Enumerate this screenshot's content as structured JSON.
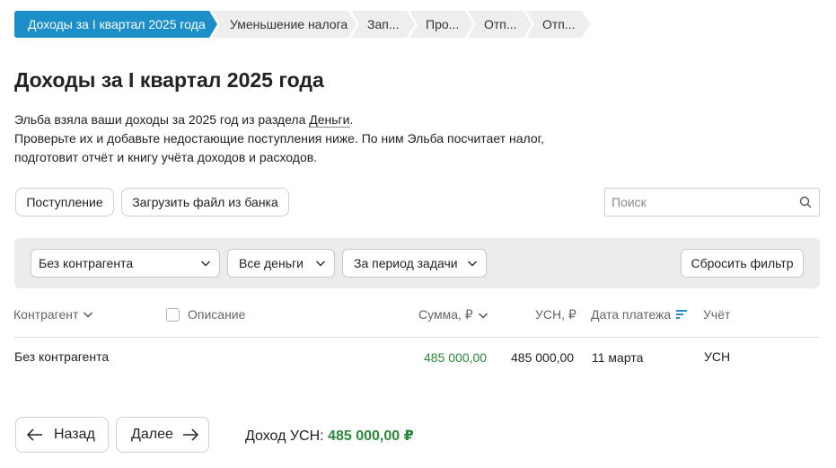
{
  "stepper": {
    "steps": [
      {
        "label": "Доходы за I квартал 2025 года",
        "active": true
      },
      {
        "label": "Уменьшение налога",
        "active": false
      },
      {
        "label": "Зап...",
        "active": false
      },
      {
        "label": "Про...",
        "active": false
      },
      {
        "label": "Отп...",
        "active": false
      },
      {
        "label": "Отп...",
        "active": false
      }
    ]
  },
  "page": {
    "title": "Доходы за I квартал 2025 года",
    "desc_line1_before": "Эльба взяла ваши доходы за 2025 год из раздела ",
    "desc_link": "Деньги",
    "desc_line1_after": ".",
    "desc_line2": "Проверьте их и добавьте недостающие поступления ниже. По ним Эльба посчитает налог,",
    "desc_line3": "подготовит отчёт и книгу учёта доходов и расходов."
  },
  "actions": {
    "income_label": "Поступление",
    "upload_label": "Загрузить файл из банка"
  },
  "search": {
    "placeholder": "Поиск",
    "icon": "search-icon"
  },
  "filters": {
    "contractor": "Без контрагента",
    "money": "Все деньги",
    "period": "За период задачи",
    "reset_label": "Сбросить фильтр"
  },
  "table": {
    "columns": {
      "contractor": "Контрагент",
      "description": "Описание",
      "amount": "Сумма, ₽",
      "usn": "УСН, ₽",
      "date": "Дата платежа",
      "accounting": "Учёт"
    },
    "rows": [
      {
        "contractor": "Без контрагента",
        "description": "",
        "amount": "485 000,00",
        "usn": "485 000,00",
        "date": "11 марта",
        "accounting": "УСН"
      }
    ]
  },
  "footer": {
    "back_label": "Назад",
    "next_label": "Далее",
    "total_label": "Доход УСН: ",
    "total_value": "485 000,00 ₽"
  },
  "colors": {
    "accent": "#1c8fc9",
    "positive": "#2a8a3a",
    "filter_bg": "#ececec"
  }
}
